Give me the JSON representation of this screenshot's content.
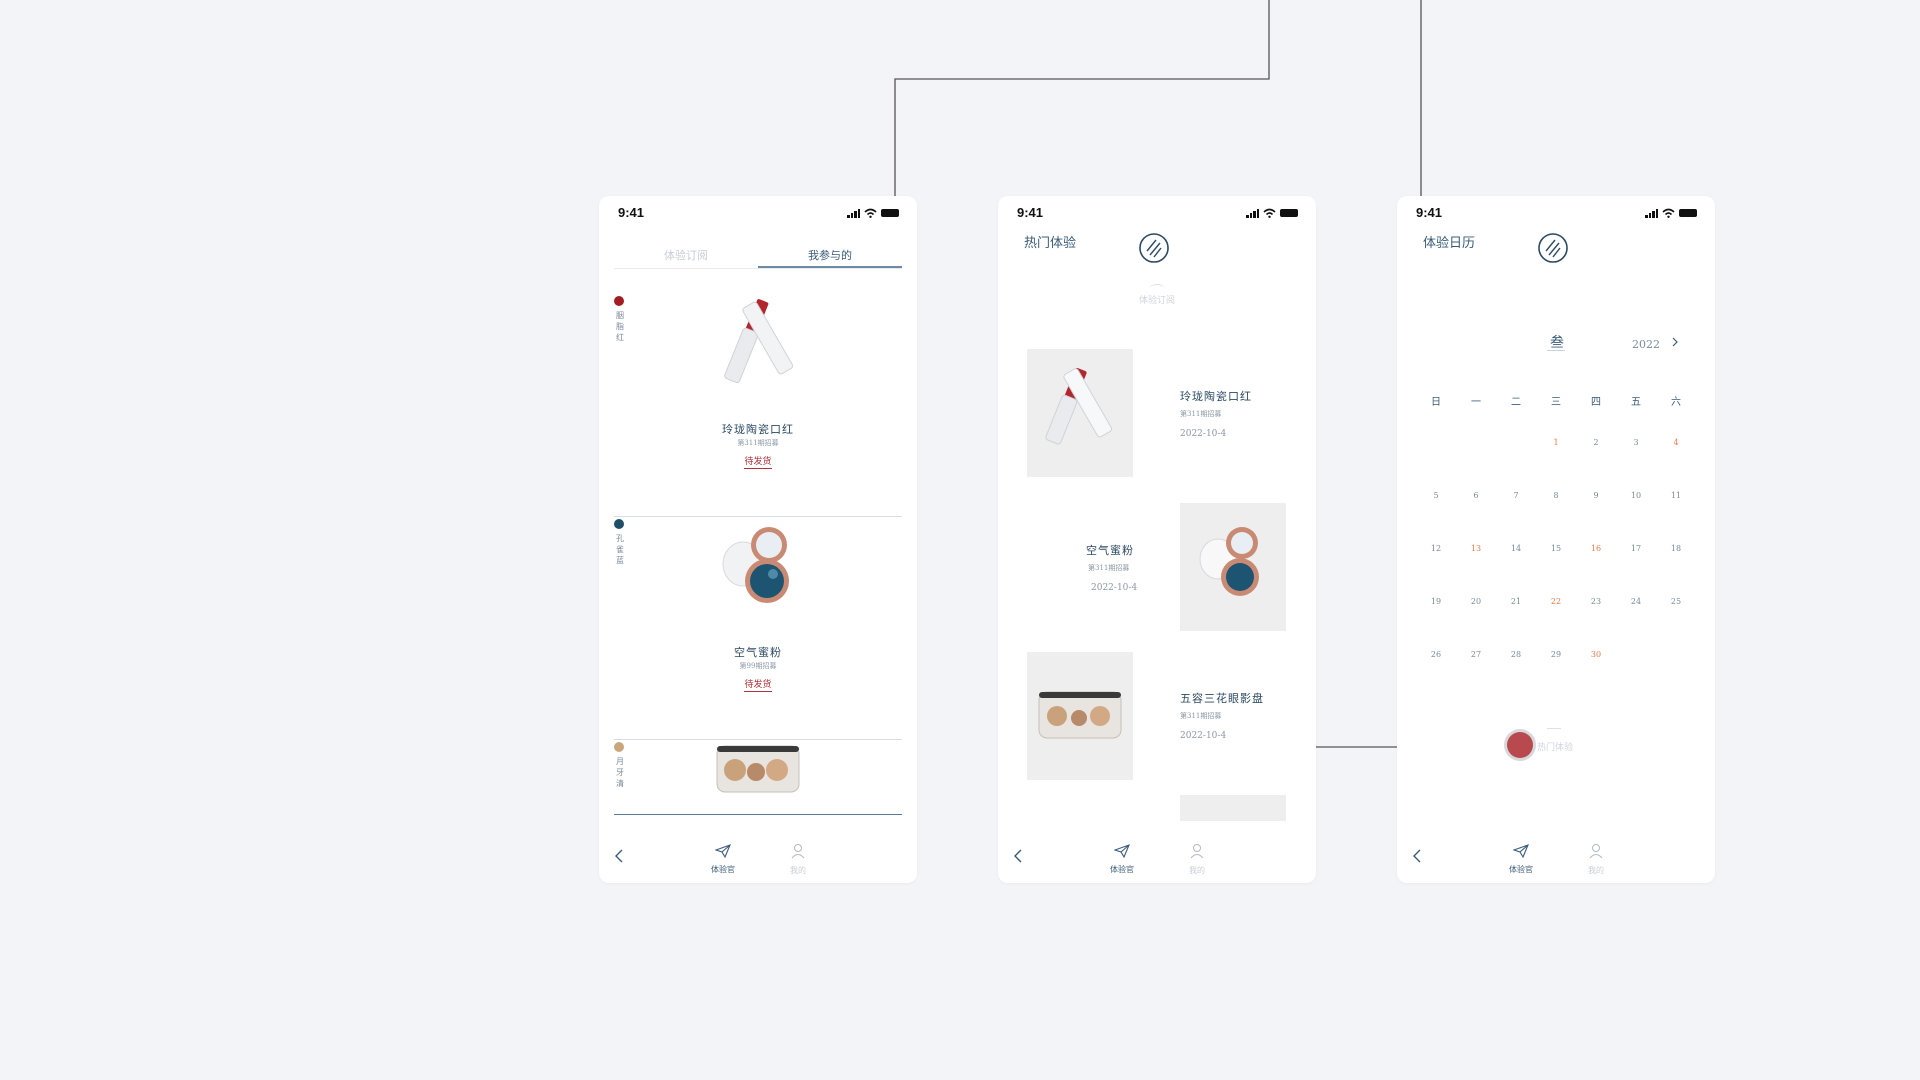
{
  "colors": {
    "background": "#f3f4f8",
    "ink": "#2c4a63",
    "accent_red": "#b0323a",
    "dot_red": "#a31e22",
    "dot_blue": "#1f4e6b",
    "dot_tan": "#c9a77a",
    "calendar_highlight": "#e27a4a",
    "button_red": "#b84a4f"
  },
  "status_bar": {
    "time": "9:41"
  },
  "screen_orders": {
    "tabs": [
      "体验订阅",
      "我参与的"
    ],
    "active_tab_index": 1,
    "products": [
      {
        "name": "玲珑陶瓷口红",
        "subtitle": "第311期招募",
        "status": "待发货",
        "dot_color": "#a31e22",
        "side_label": "胭脂红",
        "image": "lipstick"
      },
      {
        "name": "空气蜜粉",
        "subtitle": "第99期招募",
        "status": "待发货",
        "dot_color": "#1f4e6b",
        "side_label": "孔雀蓝",
        "image": "powder-compact"
      },
      {
        "name": "",
        "subtitle": "",
        "status": "",
        "dot_color": "#c9a77a",
        "side_label": "月牙清",
        "image": "eyeshadow-palette"
      }
    ]
  },
  "screen_hot": {
    "title": "热门体验",
    "ghost_title": "体验订阅",
    "items": [
      {
        "name": "玲珑陶瓷口红",
        "subtitle": "第311期招募",
        "date": "2022-10-4",
        "image": "lipstick"
      },
      {
        "name": "空气蜜粉",
        "subtitle": "第311期招募",
        "date": "2022-10-4",
        "image": "powder-compact"
      },
      {
        "name": "五容三花眼影盘",
        "subtitle": "第311期招募",
        "date": "2022-10-4",
        "image": "eyeshadow-palette"
      }
    ]
  },
  "screen_calendar": {
    "title": "体验日历",
    "month": "叁",
    "year": "2022",
    "weekdays": [
      "日",
      "一",
      "二",
      "三",
      "四",
      "五",
      "六"
    ],
    "weeks": [
      [
        "",
        "",
        "",
        "1",
        "2",
        "3",
        "4"
      ],
      [
        "5",
        "6",
        "7",
        "8",
        "9",
        "10",
        "11"
      ],
      [
        "12",
        "13",
        "14",
        "15",
        "16",
        "17",
        "18"
      ],
      [
        "19",
        "20",
        "21",
        "22",
        "23",
        "24",
        "25"
      ],
      [
        "26",
        "27",
        "28",
        "29",
        "30",
        "",
        ""
      ]
    ],
    "highlighted_days": [
      "1",
      "4",
      "13",
      "16",
      "22",
      "30"
    ],
    "button_label": "热门体验"
  },
  "bottom_nav": {
    "experience": "体验官",
    "me": "我的"
  }
}
